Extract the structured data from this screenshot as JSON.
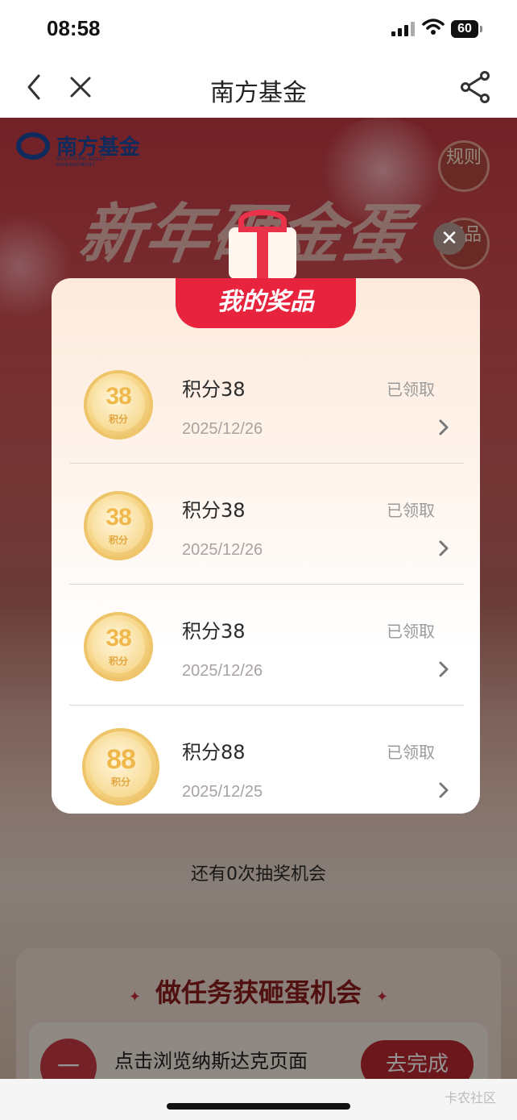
{
  "status_bar": {
    "time": "08:58",
    "battery": "60"
  },
  "nav": {
    "title": "南方基金",
    "back_icon": "chevron-left-icon",
    "close_icon": "close-icon",
    "share_icon": "share-icon"
  },
  "page": {
    "brand": {
      "name": "南方基金",
      "subtitle": "SOUTHERN ASSET MANAGEMENT"
    },
    "side_buttons": [
      {
        "label": "规则"
      },
      {
        "label": "奖品"
      }
    ],
    "banner_title": "新年砸金蛋",
    "remaining_text": "还有0次抽奖机会",
    "task_section": {
      "title": "做任务获砸蛋机会",
      "items": [
        {
          "label": "点击浏览纳斯达克页面",
          "button": "去完成",
          "icon": "一"
        }
      ]
    }
  },
  "modal": {
    "title": "我的奖品",
    "close_icon": "close-icon",
    "prizes": [
      {
        "coin_value": "38",
        "coin_unit": "积分",
        "name": "积分38",
        "status": "已领取",
        "date": "2025/12/26"
      },
      {
        "coin_value": "38",
        "coin_unit": "积分",
        "name": "积分38",
        "status": "已领取",
        "date": "2025/12/26"
      },
      {
        "coin_value": "38",
        "coin_unit": "积分",
        "name": "积分38",
        "status": "已领取",
        "date": "2025/12/26"
      },
      {
        "coin_value": "88",
        "coin_unit": "积分",
        "name": "积分88",
        "status": "已领取",
        "date": "2025/12/25"
      }
    ]
  },
  "watermark": "卡农社区",
  "colors": {
    "accent_red": "#e8233d",
    "brand_blue": "#1b4aa0",
    "coin_gold": "#f0b84a"
  }
}
